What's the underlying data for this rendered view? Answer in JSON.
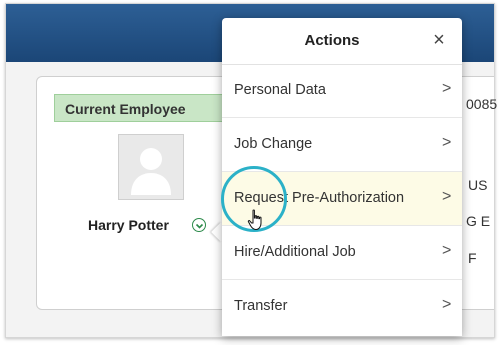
{
  "employee": {
    "badge_label": "Current Employee",
    "name": "Harry Potter"
  },
  "background_values": {
    "row1": "0085",
    "row2": "US",
    "row3": "G  E",
    "row4": "F"
  },
  "actions_menu": {
    "title": "Actions",
    "close_icon": "×",
    "items": [
      {
        "label": "Personal Data",
        "chevron": ">"
      },
      {
        "label": "Job Change",
        "chevron": ">"
      },
      {
        "label": "Request Pre-Authorization",
        "chevron": ">"
      },
      {
        "label": "Hire/Additional Job",
        "chevron": ">"
      },
      {
        "label": "Transfer",
        "chevron": ">"
      }
    ],
    "highlighted_item": "Request Pre-Authorization"
  },
  "colors": {
    "header_bar": "#1b4677",
    "badge_bg": "#c9e6c6",
    "cursor_ring": "#2bb1c8",
    "highlight_row": "#fdfbe6"
  },
  "icons": {
    "avatar": "person-silhouette-icon",
    "related_actions": "chevron-down-circle-icon",
    "cursor": "hand-pointer-icon"
  }
}
